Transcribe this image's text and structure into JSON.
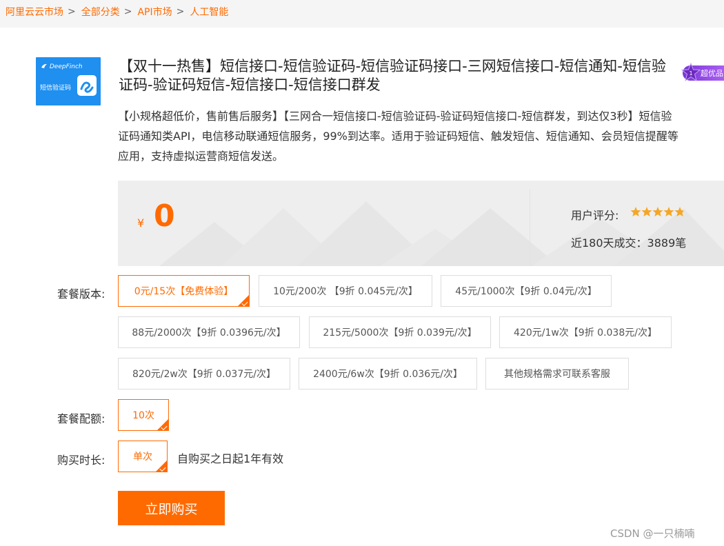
{
  "breadcrumb": {
    "items": [
      "阿里云云市场",
      "全部分类",
      "API市场",
      "人工智能"
    ],
    "separator": ">"
  },
  "product": {
    "logo_brand": "DeepFinch",
    "logo_sub": "短信验证码",
    "title": "【双十一热售】短信接口-短信验证码-短信验证码接口-三网短信接口-短信通知-短信验证码-验证码短信-短信接口-短信接口群发",
    "premium_badge": "超优品",
    "description_lines": [
      "【小规格超低价，售前售后服务】【三网合一短信接口-短信验证码-验证码短信接口-短信群发，到达仅3秒】短信验",
      "证码通知类API，电信移动联通短信服务，99%到达率。适用于验证码短信、触发短信、短信通知、会员短信提醒等",
      "应用，支持虚拟运营商短信发送。"
    ]
  },
  "price": {
    "currency": "¥",
    "amount": "0",
    "rating_label": "用户评分:",
    "rating": 4.8,
    "rating_max": 5,
    "sales": "近180天成交：3889笔"
  },
  "options": {
    "package_label": "套餐版本:",
    "packages": [
      "0元/15次【免费体验】",
      "10元/200次 【9折 0.045元/次】",
      "45元/1000次【9折 0.04元/次】",
      "88元/2000次【9折 0.0396元/次】",
      "215元/5000次【9折 0.039元/次】",
      "420元/1w次【9折 0.038元/次】",
      "820元/2w次【9折 0.037元/次】",
      "2400元/6w次【9折 0.036元/次】",
      "其他规格需求可联系客服"
    ],
    "selected_package": "0元/15次【免费体验】",
    "quota_label": "套餐配额:",
    "quota_value": "10次",
    "duration_label": "购买时长:",
    "duration_value": "单次",
    "validity": "自购买之日起1年有效"
  },
  "buy_button": "立即购买",
  "watermark": "CSDN @一只楠喃",
  "colors": {
    "accent": "#ff6a00",
    "logo_bg": "#1f8ff0",
    "premium": "#8a44e0",
    "star": "#f5a623"
  }
}
